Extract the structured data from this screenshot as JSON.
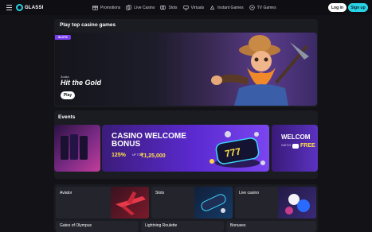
{
  "header": {
    "logo_text": "GLASSI",
    "nav": [
      {
        "label": "Promotions",
        "icon": "gift-icon"
      },
      {
        "label": "Live Casino",
        "icon": "cards-icon"
      },
      {
        "label": "Slots",
        "icon": "slot-icon"
      },
      {
        "label": "Virtuals",
        "icon": "virtual-icon"
      },
      {
        "label": "Instant Games",
        "icon": "rocket-icon"
      },
      {
        "label": "TV Games",
        "icon": "tv-icon"
      }
    ],
    "login_label": "Log in",
    "signup_label": "Sign up"
  },
  "hero": {
    "section_title": "Play top casino games",
    "badge": "SLOTS",
    "provider": "3oaks",
    "game_title": "Hit the Gold",
    "play_label": "Play"
  },
  "events": {
    "section_title": "Events",
    "main": {
      "headline_line1": "CASINO WELCOME",
      "headline_line2": "BONUS",
      "percent": "125%",
      "up_to": "UP TO",
      "amount": "₹1,25,000"
    },
    "right": {
      "headline": "WELCOM",
      "sub": "GATCH",
      "free": "FREE"
    }
  },
  "categories": [
    {
      "label": "Aviator"
    },
    {
      "label": "Slots"
    },
    {
      "label": "Live casino"
    },
    {
      "label": "Gates of Olympus"
    },
    {
      "label": "Lightning Roulette"
    },
    {
      "label": "Bonuses"
    }
  ],
  "colors": {
    "accent": "#29d3e6",
    "badge": "#7b3ff2",
    "bonus_highlight": "#ffe04a"
  }
}
